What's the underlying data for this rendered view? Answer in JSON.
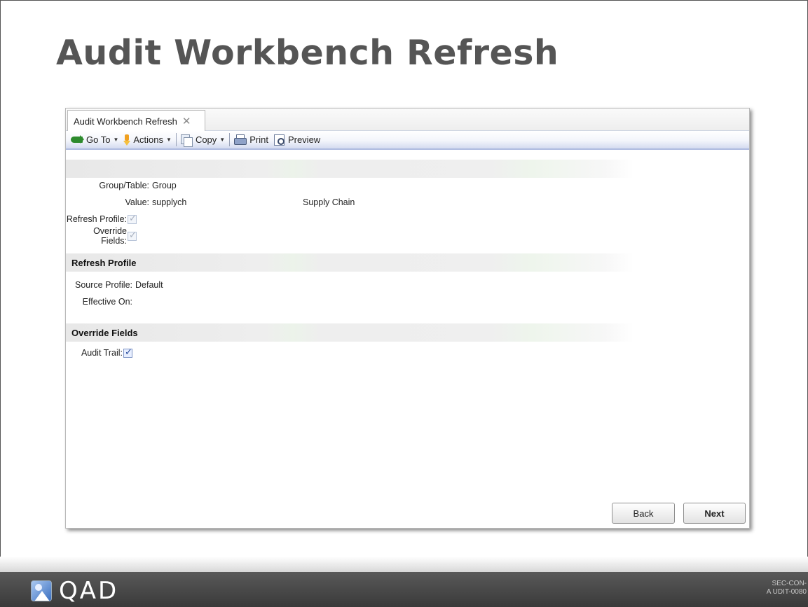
{
  "slide": {
    "title": "Audit Workbench Refresh",
    "code_line1": "SEC-CON-",
    "code_line2": "A UDIT-0080"
  },
  "window": {
    "tab_label": "Audit Workbench Refresh",
    "tab_close": "✕"
  },
  "toolbar": {
    "goto_label": "Go To",
    "actions_label": "Actions",
    "copy_label": "Copy",
    "print_label": "Print",
    "preview_label": "Preview",
    "caret": "▼"
  },
  "form": {
    "group_table_label": "Group/Table:",
    "group_table_value": "Group",
    "value_label": "Value:",
    "value_value": "supplych",
    "value_description": "Supply Chain",
    "refresh_profile_label": "Refresh Profile:",
    "refresh_profile_checked": true,
    "override_fields_label": "Override Fields:",
    "override_fields_checked": true,
    "section_refresh_profile": "Refresh Profile",
    "source_profile_label": "Source Profile:",
    "source_profile_value": "Default",
    "effective_on_label": "Effective On:",
    "effective_on_value": "",
    "section_override_fields": "Override Fields",
    "audit_trail_label": "Audit Trail:",
    "audit_trail_checked": true,
    "check_glyph": "✓"
  },
  "buttons": {
    "back": "Back",
    "next": "Next"
  },
  "footer": {
    "logo_text": "QAD"
  }
}
